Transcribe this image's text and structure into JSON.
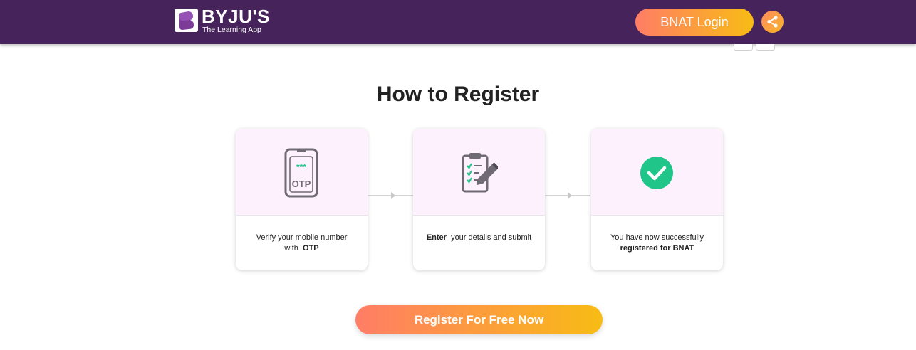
{
  "header": {
    "brand": "BYJU'S",
    "tagline": "The Learning App",
    "login_label": "BNAT Login",
    "share_icon": "share-icon",
    "colors": {
      "header_bg": "#46235a",
      "accent_start": "#ff7d66",
      "accent_end": "#f8bc14"
    }
  },
  "main": {
    "title": "How to Register",
    "steps": [
      {
        "icon": "phone-otp-icon",
        "icon_text": "OTP",
        "text_before": "Verify your mobile number with",
        "text_bold": "OTP",
        "text_after": ""
      },
      {
        "icon": "clipboard-checklist-icon",
        "text_before": "",
        "text_bold": "Enter",
        "text_after": "your details and submit"
      },
      {
        "icon": "check-circle-icon",
        "text_before": "You have now successfully",
        "text_bold": "registered for BNAT",
        "text_after": ""
      }
    ],
    "cta_label": "Register For Free Now",
    "colors": {
      "card_top_bg": "#fdf1fd",
      "icon_gray": "#6f6a73",
      "success_green": "#1fc589"
    }
  }
}
